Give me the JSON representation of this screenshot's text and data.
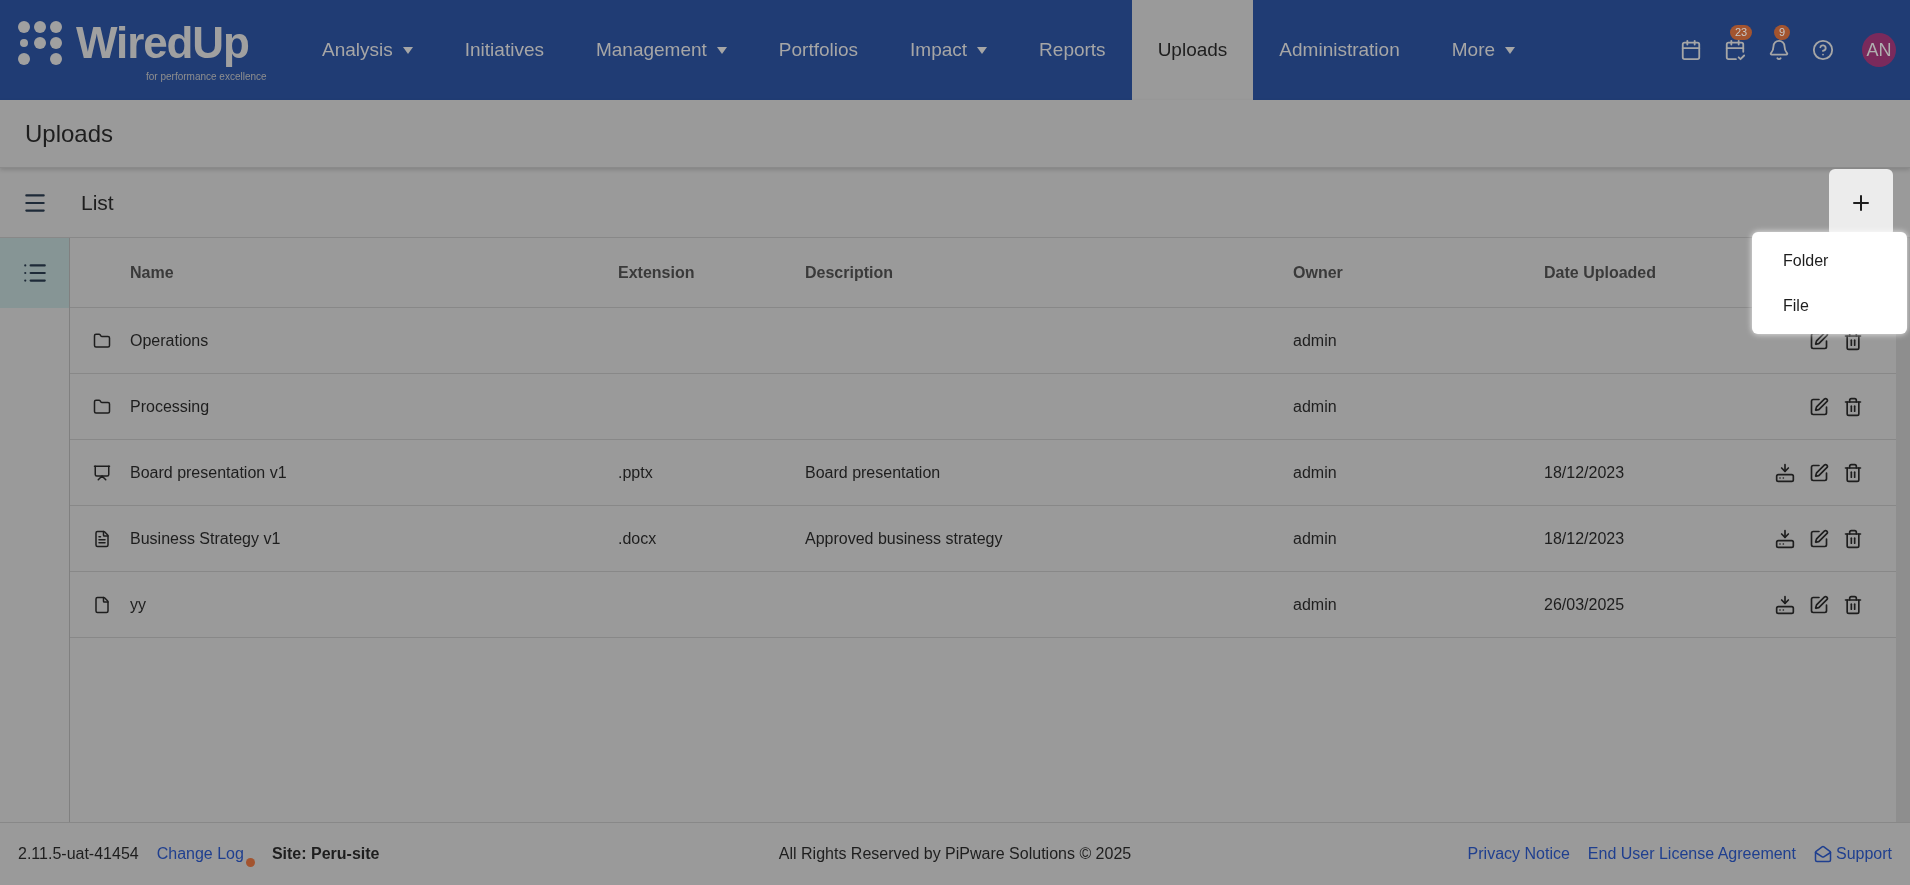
{
  "nav": {
    "logo": {
      "title": "WiredUp",
      "tagline": "for performance excellence"
    },
    "items": [
      {
        "label": "Analysis",
        "has_dropdown": true,
        "selected": false
      },
      {
        "label": "Initiatives",
        "has_dropdown": false,
        "selected": false
      },
      {
        "label": "Management",
        "has_dropdown": true,
        "selected": false
      },
      {
        "label": "Portfolios",
        "has_dropdown": false,
        "selected": false
      },
      {
        "label": "Impact",
        "has_dropdown": true,
        "selected": false
      },
      {
        "label": "Reports",
        "has_dropdown": false,
        "selected": false
      },
      {
        "label": "Uploads",
        "has_dropdown": false,
        "selected": true
      },
      {
        "label": "Administration",
        "has_dropdown": false,
        "selected": false
      },
      {
        "label": "More",
        "has_dropdown": true,
        "selected": false
      }
    ],
    "tools": [
      {
        "kind": "calendar"
      },
      {
        "kind": "tasks",
        "badge": "23"
      },
      {
        "kind": "notifications",
        "badge": "9"
      },
      {
        "kind": "help"
      }
    ],
    "avatar": "AN"
  },
  "page_title": "Uploads",
  "toolbar": {
    "title": "List"
  },
  "add_menu": {
    "items": [
      "Folder",
      "File"
    ]
  },
  "table": {
    "columns": [
      "Name",
      "Extension",
      "Description",
      "Owner",
      "Date Uploaded"
    ],
    "rows": [
      {
        "kind": "folder",
        "name": "Operations",
        "owner": "admin"
      },
      {
        "kind": "folder",
        "name": "Processing",
        "owner": "admin"
      },
      {
        "kind": "presentation",
        "name": "Board presentation v1",
        "extension": ".pptx",
        "description": "Board presentation",
        "owner": "admin",
        "date": "18/12/2023"
      },
      {
        "kind": "document",
        "name": "Business Strategy v1",
        "extension": ".docx",
        "description": "Approved business strategy",
        "owner": "admin",
        "date": "18/12/2023"
      },
      {
        "kind": "file",
        "name": "yy",
        "owner": "admin",
        "date": "26/03/2025"
      }
    ]
  },
  "footer": {
    "version": "2.11.5-uat-41454",
    "change_log": "Change Log",
    "site": "Site: Peru-site",
    "copyright": "All Rights Reserved by PiPware Solutions © 2025",
    "links": [
      "Privacy Notice",
      "End User License Agreement"
    ],
    "support": "Support"
  }
}
